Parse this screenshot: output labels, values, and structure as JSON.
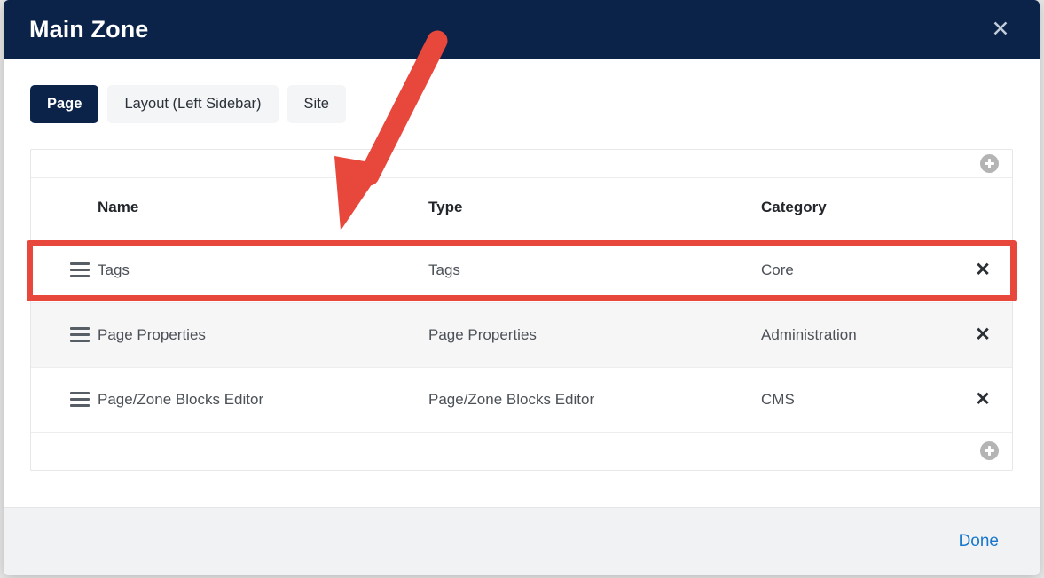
{
  "dialog": {
    "title": "Main Zone",
    "close_icon": "close-icon",
    "close_glyph": "✕"
  },
  "tabs": [
    {
      "label": "Page",
      "active": true
    },
    {
      "label": "Layout (Left Sidebar)",
      "active": false
    },
    {
      "label": "Site",
      "active": false
    }
  ],
  "table": {
    "columns": [
      "Name",
      "Type",
      "Category"
    ],
    "add_icon": "plus-circle-icon",
    "handle_icon": "drag-handle-icon",
    "delete_icon": "close-icon",
    "delete_glyph": "✕",
    "rows": [
      {
        "name": "Tags",
        "type": "Tags",
        "category": "Core",
        "highlighted": true
      },
      {
        "name": "Page Properties",
        "type": "Page Properties",
        "category": "Administration",
        "highlighted": false
      },
      {
        "name": "Page/Zone Blocks Editor",
        "type": "Page/Zone Blocks Editor",
        "category": "CMS",
        "highlighted": false
      }
    ]
  },
  "footer": {
    "done_label": "Done"
  },
  "annotations": {
    "highlight_color": "#e8483c",
    "arrow_color": "#e8483c",
    "arrow_target": "tags-row"
  },
  "colors": {
    "header_bg": "#0b2349",
    "accent_link": "#1877cc",
    "tab_active_bg": "#0b2349",
    "tab_inactive_bg": "#f4f5f6",
    "footer_bg": "#f1f2f3",
    "row_stripe": "#f6f6f7"
  }
}
